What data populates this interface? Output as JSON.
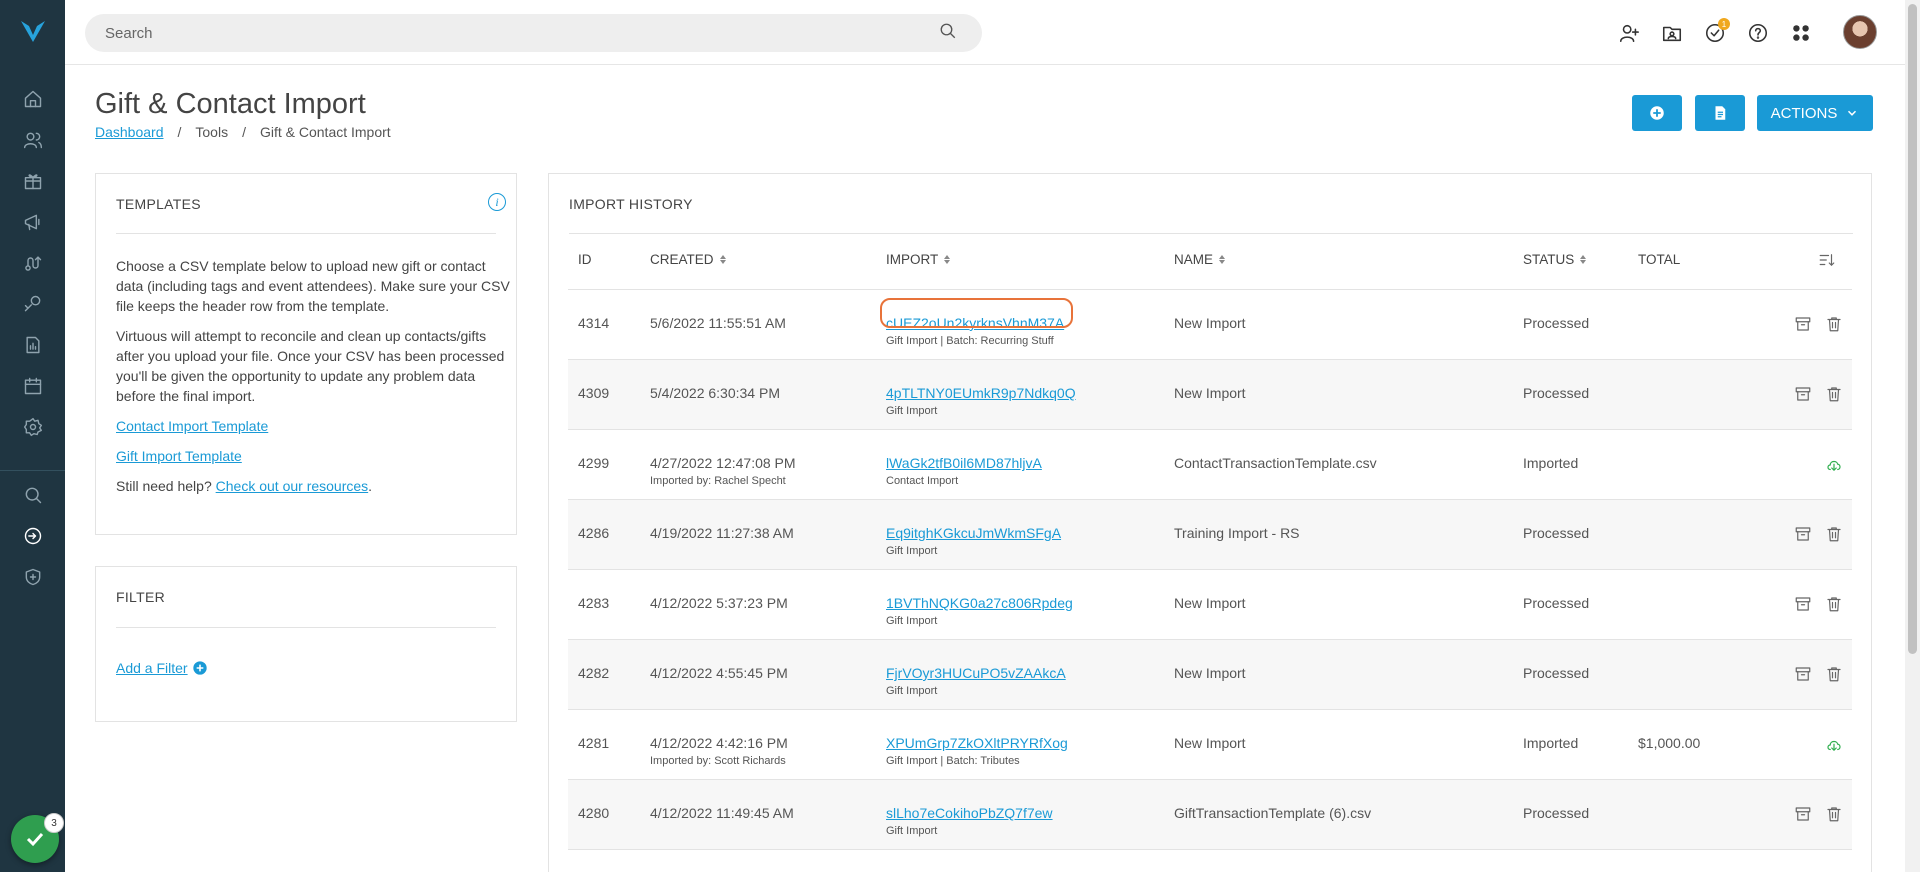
{
  "search": {
    "placeholder": "Search"
  },
  "notifications": {
    "count": "1"
  },
  "sidebar": {
    "badge_count": "3"
  },
  "page": {
    "title": "Gift & Contact Import",
    "breadcrumb": [
      "Dashboard",
      "Tools",
      "Gift & Contact Import"
    ]
  },
  "header_buttons": {
    "actions_label": "ACTIONS"
  },
  "templates": {
    "title": "TEMPLATES",
    "para1": "Choose a CSV template below to upload new gift or contact data (including tags and event attendees). Make sure your CSV file keeps the header row from the template.",
    "para2": "Virtuous will attempt to reconcile and clean up contacts/gifts after you upload your file. Once your CSV has been processed you'll be given the opportunity to update any problem data before the final import.",
    "link1": "Contact Import Template",
    "link2": "Gift Import Template",
    "help_prefix": "Still need help? ",
    "help_link": "Check out our resources",
    "help_suffix": "."
  },
  "filter": {
    "title": "FILTER",
    "add_label": "Add a Filter"
  },
  "history": {
    "title": "IMPORT HISTORY",
    "columns": {
      "id": "ID",
      "created": "CREATED",
      "import": "IMPORT",
      "name": "NAME",
      "status": "STATUS",
      "total": "TOTAL"
    },
    "rows": [
      {
        "id": "4314",
        "created": "5/6/2022 11:55:51 AM",
        "created_sub": "",
        "import": "cUEZ2oUn2kyrknsVhnM37A",
        "import_sub": "Gift Import | Batch: Recurring Stuff",
        "name": "New Import",
        "status": "Processed",
        "total": ""
      },
      {
        "id": "4309",
        "created": "5/4/2022 6:30:34 PM",
        "created_sub": "",
        "import": "4pTLTNY0EUmkR9p7Ndkq0Q",
        "import_sub": "Gift Import",
        "name": "New Import",
        "status": "Processed",
        "total": ""
      },
      {
        "id": "4299",
        "created": "4/27/2022 12:47:08 PM",
        "created_sub": "Imported by: Rachel Specht",
        "import": "lWaGk2tfB0il6MD87hljvA",
        "import_sub": "Contact Import",
        "name": "ContactTransactionTemplate.csv",
        "status": "Imported",
        "total": ""
      },
      {
        "id": "4286",
        "created": "4/19/2022 11:27:38 AM",
        "created_sub": "",
        "import": "Eq9itghKGkcuJmWkmSFgA",
        "import_sub": "Gift Import",
        "name": "Training Import - RS",
        "status": "Processed",
        "total": ""
      },
      {
        "id": "4283",
        "created": "4/12/2022 5:37:23 PM",
        "created_sub": "",
        "import": "1BVThNQKG0a27c806Rpdeg",
        "import_sub": "Gift Import",
        "name": "New Import",
        "status": "Processed",
        "total": ""
      },
      {
        "id": "4282",
        "created": "4/12/2022 4:55:45 PM",
        "created_sub": "",
        "import": "FjrVOyr3HUCuPO5vZAAkcA",
        "import_sub": "Gift Import",
        "name": "New Import",
        "status": "Processed",
        "total": ""
      },
      {
        "id": "4281",
        "created": "4/12/2022 4:42:16 PM",
        "created_sub": "Imported by: Scott Richards",
        "import": "XPUmGrp7ZkOXltPRYRfXog",
        "import_sub": "Gift Import | Batch: Tributes",
        "name": "New Import",
        "status": "Imported",
        "total": "$1,000.00"
      },
      {
        "id": "4280",
        "created": "4/12/2022 11:49:45 AM",
        "created_sub": "",
        "import": "slLho7eCokihoPbZQ7f7ew",
        "import_sub": "Gift Import",
        "name": "GiftTransactionTemplate (6).csv",
        "status": "Processed",
        "total": ""
      }
    ]
  }
}
